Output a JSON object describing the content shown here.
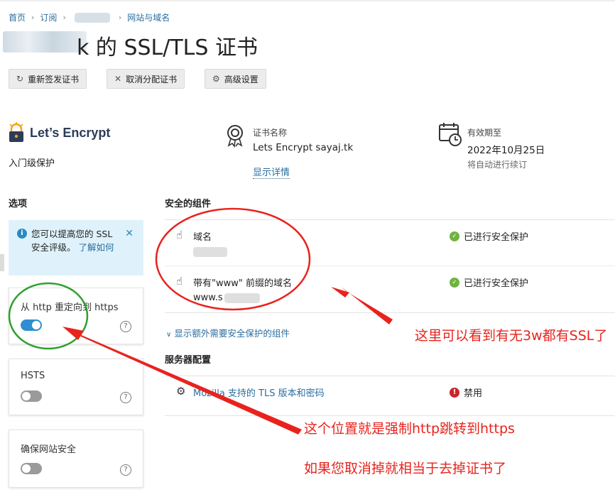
{
  "breadcrumb": {
    "items": [
      "首页",
      "订阅",
      "网站与域名"
    ],
    "separator": "›"
  },
  "page": {
    "title": "k 的 SSL/TLS 证书"
  },
  "toolbar": {
    "reissue_label": "重新签发证书",
    "unassign_label": "取消分配证书",
    "advanced_label": "高级设置"
  },
  "certificate": {
    "brand_name": "Let’s Encrypt",
    "level": "入门级保护",
    "name_label": "证书名称",
    "name_value": "Lets Encrypt sayaj.tk",
    "details_link": "显示详情",
    "expiry_label": "有效期至",
    "expiry_value": "2022年10月25日",
    "renew_note": "将自动进行续订"
  },
  "options": {
    "heading": "选项",
    "info_text": "您可以提高您的 SSL 安全评级。",
    "info_link": "了解如何",
    "redirect_label": "从 http 重定向到 https",
    "redirect_on": true,
    "hsts_label": "HSTS",
    "hsts_on": false,
    "secure_site_label": "确保网站安全",
    "secure_site_on": false,
    "help_glyph": "?"
  },
  "components": {
    "heading": "安全的组件",
    "rows": [
      {
        "label": "域名",
        "value": "",
        "status": "已进行安全保护"
      },
      {
        "label": "带有\"www\" 前缀的域名",
        "value": "www.s",
        "status": "已进行安全保护"
      }
    ],
    "more_link": "显示额外需要安全保护的组件"
  },
  "server_config": {
    "heading": "服务器配置",
    "rows": [
      {
        "label": "Mozilla 支持的 TLS 版本和密码",
        "status": "禁用"
      }
    ]
  },
  "annotations": {
    "note_www": "这里可以看到有无3w都有SSL了",
    "note_redirect": "这个位置就是强制http跳转到https",
    "note_cancel": "如果您取消掉就相当于去掉证书了"
  },
  "colors": {
    "link": "#2a6e9e",
    "annotation": "#e8231d",
    "ok": "#6fb340",
    "error": "#c8262d",
    "toggle_on": "#2f8ed1"
  }
}
